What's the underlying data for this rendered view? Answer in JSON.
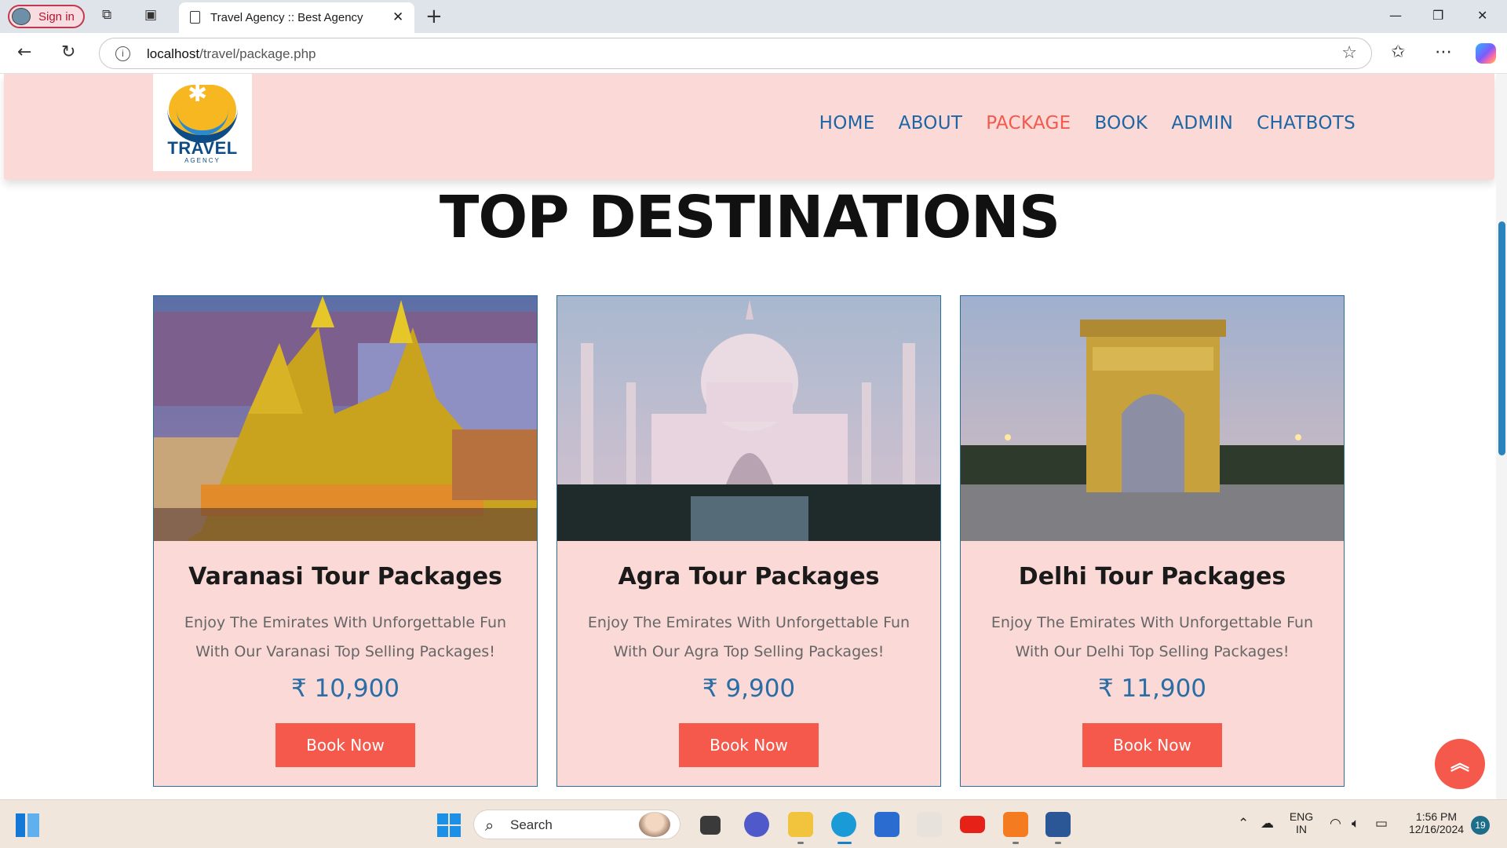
{
  "browser": {
    "signin_label": "Sign in",
    "tab_title": "Travel Agency :: Best Agency",
    "url_host": "localhost",
    "url_path": "/travel/package.php"
  },
  "site": {
    "logo_word": "TRAVEL",
    "logo_sub": "AGENCY",
    "nav": [
      {
        "label": "HOME",
        "active": false
      },
      {
        "label": "ABOUT",
        "active": false
      },
      {
        "label": "PACKAGE",
        "active": true
      },
      {
        "label": "BOOK",
        "active": false
      },
      {
        "label": "ADMIN",
        "active": false
      },
      {
        "label": "CHATBOTS",
        "active": false
      }
    ],
    "heading": "TOP DESTINATIONS"
  },
  "cards": [
    {
      "title": "Varanasi Tour Packages",
      "desc": "Enjoy The Emirates With Unforgettable Fun With Our Varanasi Top Selling Packages!",
      "price": "₹ 10,900",
      "button": "Book Now",
      "image": "varanasi-temple-photo"
    },
    {
      "title": "Agra Tour Packages",
      "desc": "Enjoy The Emirates With Unforgettable Fun With Our Agra Top Selling Packages!",
      "price": "₹ 9,900",
      "button": "Book Now",
      "image": "taj-mahal-photo"
    },
    {
      "title": "Delhi Tour Packages",
      "desc": "Enjoy The Emirates With Unforgettable Fun With Our Delhi Top Selling Packages!",
      "price": "₹ 11,900",
      "button": "Book Now",
      "image": "india-gate-photo"
    }
  ],
  "taskbar": {
    "search_label": "Search",
    "lang_line1": "ENG",
    "lang_line2": "IN",
    "time": "1:56 PM",
    "date": "12/16/2024",
    "notifications": "19"
  },
  "colors": {
    "accent": "#f4594c",
    "nav_link": "#1e66a3",
    "header_bg": "#fad9d7",
    "price": "#2a6ea5"
  }
}
